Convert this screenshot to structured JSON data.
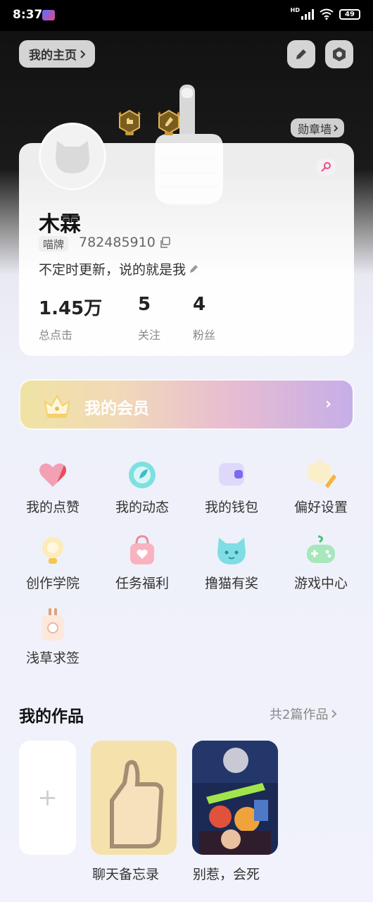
{
  "status": {
    "time": "8:37",
    "network": "HD",
    "battery": "49"
  },
  "header": {
    "homepage_label": "我的主页",
    "badge_wall_label": "勋章墙"
  },
  "profile": {
    "name": "木霖",
    "nameplate_tag": "喵牌",
    "uid": "782485910",
    "bio": "不定时更新，说的就是我",
    "stats": [
      {
        "value": "1.45万",
        "label": "总点击"
      },
      {
        "value": "5",
        "label": "关注"
      },
      {
        "value": "4",
        "label": "粉丝"
      }
    ]
  },
  "membership": {
    "label": "我的会员"
  },
  "grid": [
    {
      "label": "我的点赞",
      "icon": "heart-icon"
    },
    {
      "label": "我的动态",
      "icon": "moments-icon"
    },
    {
      "label": "我的钱包",
      "icon": "wallet-icon"
    },
    {
      "label": "偏好设置",
      "icon": "preferences-icon"
    },
    {
      "label": "创作学院",
      "icon": "lightbulb-icon"
    },
    {
      "label": "任务福利",
      "icon": "gift-bag-icon"
    },
    {
      "label": "撸猫有奖",
      "icon": "cat-icon"
    },
    {
      "label": "游戏中心",
      "icon": "gamepad-icon"
    },
    {
      "label": "浅草求签",
      "icon": "fortune-stick-icon"
    }
  ],
  "works": {
    "title": "我的作品",
    "count_label": "共2篇作品",
    "add_label": "+",
    "items": [
      {
        "title": "聊天备忘录"
      },
      {
        "title": "别惹，会死"
      }
    ]
  },
  "colors": {
    "accent_pink": "#e94c86",
    "member_gold": "#efe3a3",
    "member_purple": "#c6aee8"
  }
}
